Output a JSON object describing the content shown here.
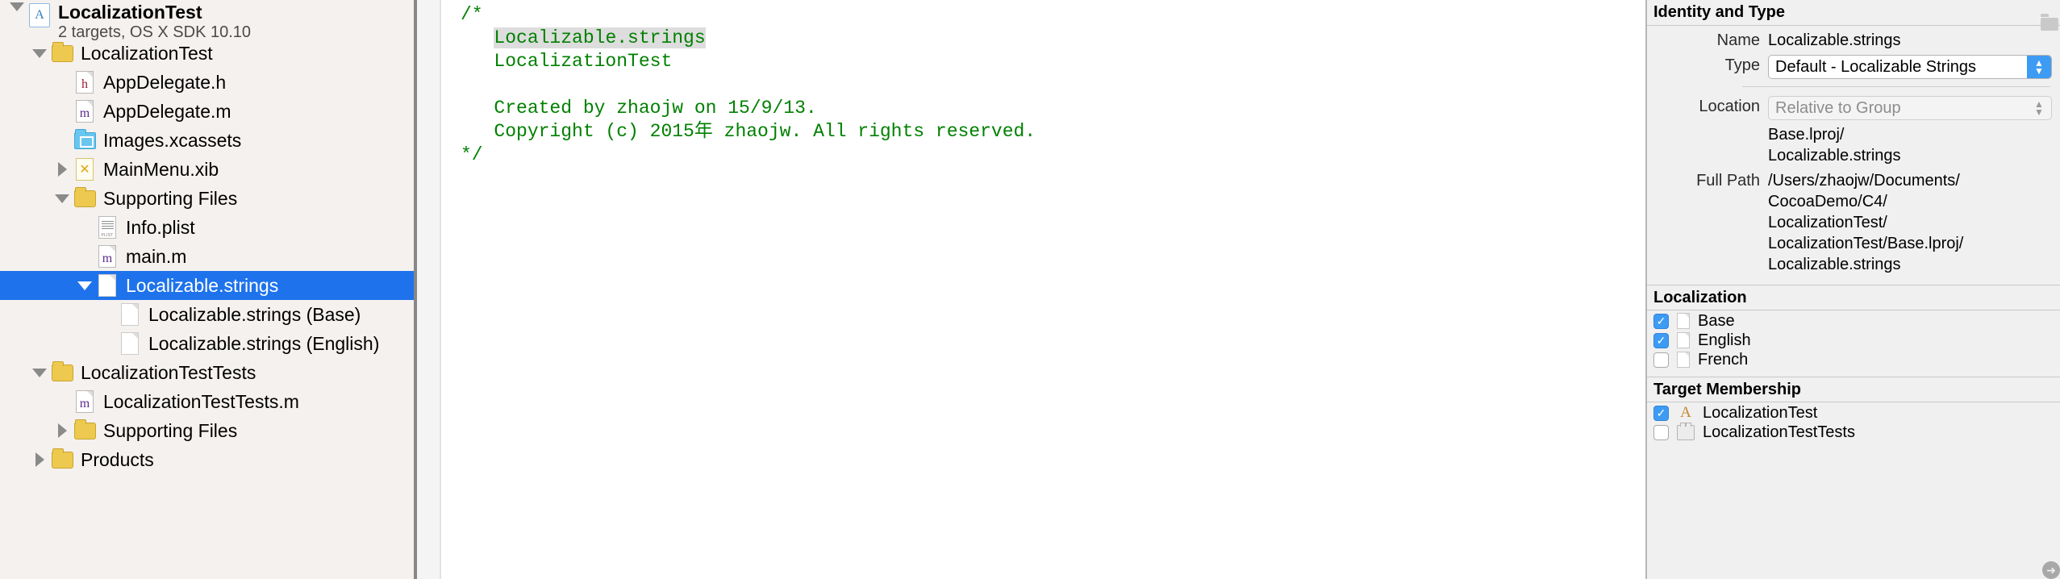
{
  "navigator": {
    "rows": [
      {
        "label": "LocalizationTest",
        "sublabel": "2 targets, OS X SDK 10.10",
        "icon": "xcodeproj-icon",
        "twisty": "down",
        "indent": 0,
        "kind": "project",
        "selected": false
      },
      {
        "label": "LocalizationTest",
        "icon": "folder-icon",
        "twisty": "down",
        "indent": 1,
        "kind": "folder",
        "selected": false
      },
      {
        "label": "AppDelegate.h",
        "icon": "header-file-icon",
        "glyph": "h",
        "twisty": "none",
        "indent": 2,
        "kind": "file",
        "selected": false
      },
      {
        "label": "AppDelegate.m",
        "icon": "objc-file-icon",
        "glyph": "m",
        "twisty": "none",
        "indent": 2,
        "kind": "file",
        "selected": false
      },
      {
        "label": "Images.xcassets",
        "icon": "xcassets-icon",
        "twisty": "none",
        "indent": 2,
        "kind": "assets",
        "selected": false
      },
      {
        "label": "MainMenu.xib",
        "icon": "xib-file-icon",
        "twisty": "right",
        "indent": 2,
        "kind": "xib",
        "selected": false
      },
      {
        "label": "Supporting Files",
        "icon": "folder-icon",
        "twisty": "down",
        "indent": 2,
        "kind": "folder",
        "selected": false
      },
      {
        "label": "Info.plist",
        "icon": "plist-file-icon",
        "twisty": "none",
        "indent": 3,
        "kind": "plist",
        "selected": false
      },
      {
        "label": "main.m",
        "icon": "objc-file-icon",
        "glyph": "m",
        "twisty": "none",
        "indent": 3,
        "kind": "file",
        "selected": false
      },
      {
        "label": "Localizable.strings",
        "icon": "strings-file-icon",
        "twisty": "down",
        "indent": 3,
        "kind": "strings",
        "selected": true
      },
      {
        "label": "Localizable.strings (Base)",
        "icon": "strings-file-icon",
        "twisty": "none",
        "indent": 4,
        "kind": "strings",
        "selected": false
      },
      {
        "label": "Localizable.strings (English)",
        "icon": "strings-file-icon",
        "twisty": "none",
        "indent": 4,
        "kind": "strings",
        "selected": false
      },
      {
        "label": "LocalizationTestTests",
        "icon": "folder-icon",
        "twisty": "down",
        "indent": 1,
        "kind": "folder",
        "selected": false
      },
      {
        "label": "LocalizationTestTests.m",
        "icon": "objc-file-icon",
        "glyph": "m",
        "twisty": "none",
        "indent": 2,
        "kind": "file",
        "selected": false
      },
      {
        "label": "Supporting Files",
        "icon": "folder-icon",
        "twisty": "right",
        "indent": 2,
        "kind": "folder",
        "selected": false
      },
      {
        "label": "Products",
        "icon": "folder-icon",
        "twisty": "right",
        "indent": 1,
        "kind": "folder",
        "selected": false
      }
    ],
    "selection_color": "#1e73ec",
    "background_color": "#f5f1ee"
  },
  "editor": {
    "lines": [
      {
        "text": "/*",
        "highlight": false
      },
      {
        "text": "   Localizable.strings",
        "highlight": true,
        "highlight_text": "Localizable.strings",
        "prefix": "   "
      },
      {
        "text": "   LocalizationTest",
        "highlight": false
      },
      {
        "text": "",
        "highlight": false
      },
      {
        "text": "   Created by zhaojw on 15/9/13.",
        "highlight": false
      },
      {
        "text": "   Copyright (c) 2015年 zhaojw. All rights reserved.",
        "highlight": false
      },
      {
        "text": "*/",
        "highlight": false
      }
    ],
    "text_color": "#008000"
  },
  "inspector": {
    "identity": {
      "header": "Identity and Type",
      "name_label": "Name",
      "name_value": "Localizable.strings",
      "type_label": "Type",
      "type_value": "Default - Localizable Strings",
      "location_label": "Location",
      "location_value": "Relative to Group",
      "relative_path": "Base.lproj/\nLocalizable.strings",
      "full_path_label": "Full Path",
      "full_path_value": "/Users/zhaojw/Documents/\nCocoaDemo/C4/\nLocalizationTest/\nLocalizationTest/Base.lproj/\nLocalizable.strings"
    },
    "localization": {
      "header": "Localization",
      "items": [
        {
          "label": "Base",
          "checked": true
        },
        {
          "label": "English",
          "checked": true
        },
        {
          "label": "French",
          "checked": false
        }
      ]
    },
    "target_membership": {
      "header": "Target Membership",
      "items": [
        {
          "label": "LocalizationTest",
          "checked": true,
          "icon": "app-target-icon"
        },
        {
          "label": "LocalizationTestTests",
          "checked": false,
          "icon": "test-target-icon"
        }
      ]
    },
    "accent_color": "#3e9bf4"
  }
}
